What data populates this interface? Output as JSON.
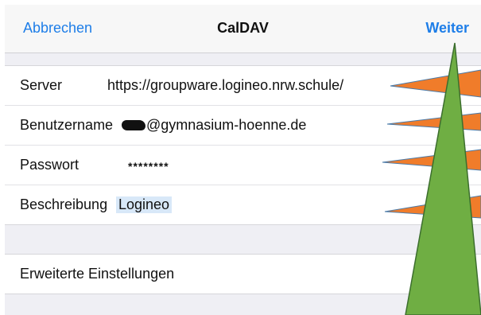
{
  "navbar": {
    "cancel_label": "Abbrechen",
    "title": "CalDAV",
    "next_label": "Weiter"
  },
  "form": {
    "server": {
      "label": "Server",
      "value": "https://groupware.logineo.nrw.schule/"
    },
    "username": {
      "label": "Benutzername",
      "value_suffix": "@gymnasium-hoenne.de"
    },
    "password": {
      "label": "Passwort",
      "value": "********"
    },
    "description": {
      "label": "Beschreibung",
      "value": "Logineo"
    }
  },
  "advanced": {
    "label": "Erweiterte Einstellungen"
  },
  "colors": {
    "accent": "#1e7ee8",
    "annotation_orange": "#f07c2a",
    "annotation_green": "#6fae43"
  }
}
